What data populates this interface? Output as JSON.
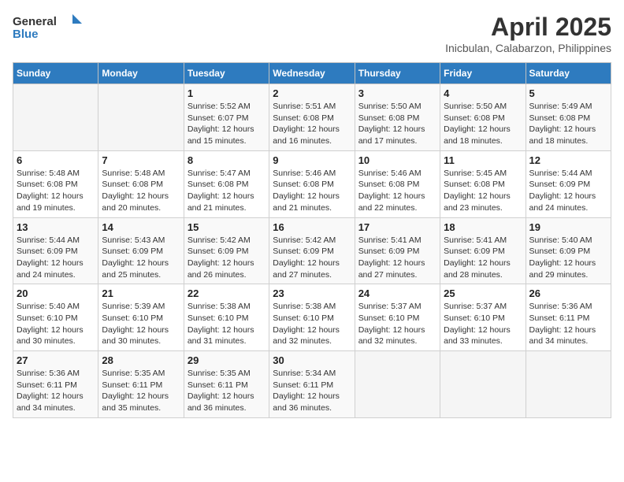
{
  "header": {
    "logo_general": "General",
    "logo_blue": "Blue",
    "title": "April 2025",
    "subtitle": "Inicbulan, Calabarzon, Philippines"
  },
  "weekdays": [
    "Sunday",
    "Monday",
    "Tuesday",
    "Wednesday",
    "Thursday",
    "Friday",
    "Saturday"
  ],
  "weeks": [
    [
      {
        "day": "",
        "info": ""
      },
      {
        "day": "",
        "info": ""
      },
      {
        "day": "1",
        "info": "Sunrise: 5:52 AM\nSunset: 6:07 PM\nDaylight: 12 hours and 15 minutes."
      },
      {
        "day": "2",
        "info": "Sunrise: 5:51 AM\nSunset: 6:08 PM\nDaylight: 12 hours and 16 minutes."
      },
      {
        "day": "3",
        "info": "Sunrise: 5:50 AM\nSunset: 6:08 PM\nDaylight: 12 hours and 17 minutes."
      },
      {
        "day": "4",
        "info": "Sunrise: 5:50 AM\nSunset: 6:08 PM\nDaylight: 12 hours and 18 minutes."
      },
      {
        "day": "5",
        "info": "Sunrise: 5:49 AM\nSunset: 6:08 PM\nDaylight: 12 hours and 18 minutes."
      }
    ],
    [
      {
        "day": "6",
        "info": "Sunrise: 5:48 AM\nSunset: 6:08 PM\nDaylight: 12 hours and 19 minutes."
      },
      {
        "day": "7",
        "info": "Sunrise: 5:48 AM\nSunset: 6:08 PM\nDaylight: 12 hours and 20 minutes."
      },
      {
        "day": "8",
        "info": "Sunrise: 5:47 AM\nSunset: 6:08 PM\nDaylight: 12 hours and 21 minutes."
      },
      {
        "day": "9",
        "info": "Sunrise: 5:46 AM\nSunset: 6:08 PM\nDaylight: 12 hours and 21 minutes."
      },
      {
        "day": "10",
        "info": "Sunrise: 5:46 AM\nSunset: 6:08 PM\nDaylight: 12 hours and 22 minutes."
      },
      {
        "day": "11",
        "info": "Sunrise: 5:45 AM\nSunset: 6:08 PM\nDaylight: 12 hours and 23 minutes."
      },
      {
        "day": "12",
        "info": "Sunrise: 5:44 AM\nSunset: 6:09 PM\nDaylight: 12 hours and 24 minutes."
      }
    ],
    [
      {
        "day": "13",
        "info": "Sunrise: 5:44 AM\nSunset: 6:09 PM\nDaylight: 12 hours and 24 minutes."
      },
      {
        "day": "14",
        "info": "Sunrise: 5:43 AM\nSunset: 6:09 PM\nDaylight: 12 hours and 25 minutes."
      },
      {
        "day": "15",
        "info": "Sunrise: 5:42 AM\nSunset: 6:09 PM\nDaylight: 12 hours and 26 minutes."
      },
      {
        "day": "16",
        "info": "Sunrise: 5:42 AM\nSunset: 6:09 PM\nDaylight: 12 hours and 27 minutes."
      },
      {
        "day": "17",
        "info": "Sunrise: 5:41 AM\nSunset: 6:09 PM\nDaylight: 12 hours and 27 minutes."
      },
      {
        "day": "18",
        "info": "Sunrise: 5:41 AM\nSunset: 6:09 PM\nDaylight: 12 hours and 28 minutes."
      },
      {
        "day": "19",
        "info": "Sunrise: 5:40 AM\nSunset: 6:09 PM\nDaylight: 12 hours and 29 minutes."
      }
    ],
    [
      {
        "day": "20",
        "info": "Sunrise: 5:40 AM\nSunset: 6:10 PM\nDaylight: 12 hours and 30 minutes."
      },
      {
        "day": "21",
        "info": "Sunrise: 5:39 AM\nSunset: 6:10 PM\nDaylight: 12 hours and 30 minutes."
      },
      {
        "day": "22",
        "info": "Sunrise: 5:38 AM\nSunset: 6:10 PM\nDaylight: 12 hours and 31 minutes."
      },
      {
        "day": "23",
        "info": "Sunrise: 5:38 AM\nSunset: 6:10 PM\nDaylight: 12 hours and 32 minutes."
      },
      {
        "day": "24",
        "info": "Sunrise: 5:37 AM\nSunset: 6:10 PM\nDaylight: 12 hours and 32 minutes."
      },
      {
        "day": "25",
        "info": "Sunrise: 5:37 AM\nSunset: 6:10 PM\nDaylight: 12 hours and 33 minutes."
      },
      {
        "day": "26",
        "info": "Sunrise: 5:36 AM\nSunset: 6:11 PM\nDaylight: 12 hours and 34 minutes."
      }
    ],
    [
      {
        "day": "27",
        "info": "Sunrise: 5:36 AM\nSunset: 6:11 PM\nDaylight: 12 hours and 34 minutes."
      },
      {
        "day": "28",
        "info": "Sunrise: 5:35 AM\nSunset: 6:11 PM\nDaylight: 12 hours and 35 minutes."
      },
      {
        "day": "29",
        "info": "Sunrise: 5:35 AM\nSunset: 6:11 PM\nDaylight: 12 hours and 36 minutes."
      },
      {
        "day": "30",
        "info": "Sunrise: 5:34 AM\nSunset: 6:11 PM\nDaylight: 12 hours and 36 minutes."
      },
      {
        "day": "",
        "info": ""
      },
      {
        "day": "",
        "info": ""
      },
      {
        "day": "",
        "info": ""
      }
    ]
  ]
}
